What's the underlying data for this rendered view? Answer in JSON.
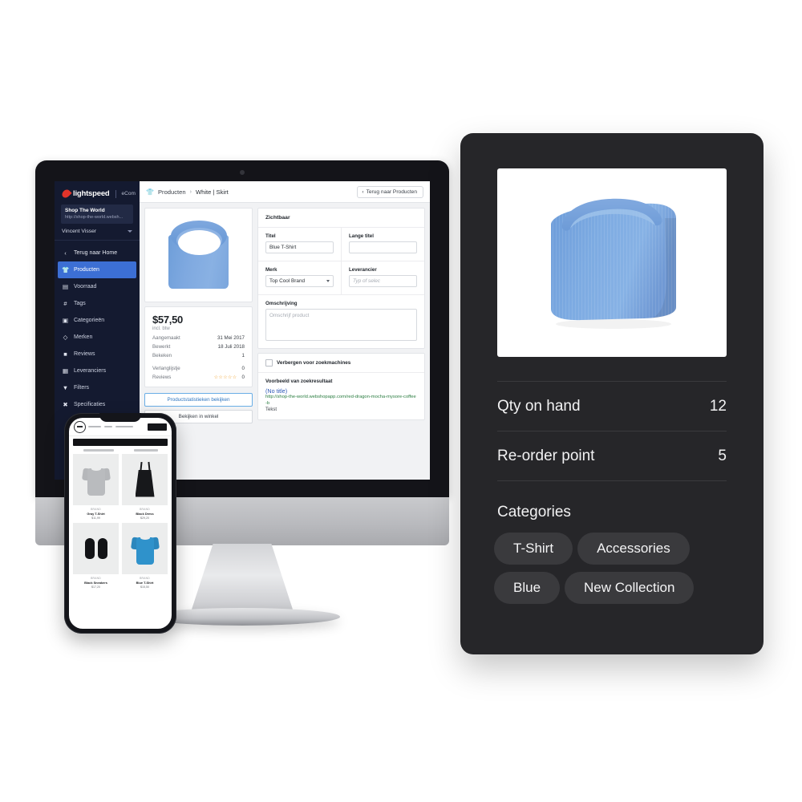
{
  "admin": {
    "brand": {
      "name": "lightspeed",
      "product": "eCom",
      "logo_icon": "flame-icon"
    },
    "shop": {
      "name": "Shop The World",
      "url": "http://shop-the-world.websh..."
    },
    "user": {
      "name": "Vincent Visser"
    },
    "nav": [
      {
        "label": "Terug naar Home",
        "icon": "chevron-left-icon",
        "active": false
      },
      {
        "label": "Producten",
        "icon": "tshirt-icon",
        "active": true
      },
      {
        "label": "Voorraad",
        "icon": "box-icon",
        "active": false
      },
      {
        "label": "Tags",
        "icon": "hash-icon",
        "active": false
      },
      {
        "label": "Categorieën",
        "icon": "folder-icon",
        "active": false
      },
      {
        "label": "Merken",
        "icon": "tag-icon",
        "active": false
      },
      {
        "label": "Reviews",
        "icon": "comment-icon",
        "active": false
      },
      {
        "label": "Leveranciers",
        "icon": "bank-icon",
        "active": false
      },
      {
        "label": "Filters",
        "icon": "filter-icon",
        "active": false
      },
      {
        "label": "Specificaties",
        "icon": "wrench-icon",
        "active": false
      }
    ],
    "breadcrumb": {
      "icon": "tshirt-icon",
      "root": "Producten",
      "separator": "›",
      "current": "White | Skirt"
    },
    "back_button": {
      "label": "Terug naar Producten",
      "icon": "chevron-left-icon"
    },
    "stats": {
      "price": "$57,50",
      "price_note": "incl. btw",
      "rows": [
        {
          "label": "Aangemaakt",
          "value": "31 Mei 2017"
        },
        {
          "label": "Bewerkt",
          "value": "18 Juli 2018"
        },
        {
          "label": "Bekeken",
          "value": "1"
        }
      ],
      "rows2": [
        {
          "label": "Verlanglijstje",
          "value": "0"
        },
        {
          "label": "Reviews",
          "value": "0",
          "stars": "☆☆☆☆☆"
        }
      ],
      "stats_button": "Productstatistieken bekijken",
      "shop_button": "Bekijken in winkel"
    },
    "form": {
      "section_title": "Zichtbaar",
      "title_label": "Titel",
      "title_value": "Blue T-Shirt",
      "long_title_label": "Lange titel",
      "long_title_value": "",
      "brand_label": "Merk",
      "brand_value": "Top Cool Brand",
      "supplier_label": "Leverancier",
      "supplier_placeholder": "Typ of selec",
      "description_label": "Omschrijving",
      "description_placeholder": "Omschrijf product",
      "hide_label": "Verbergen voor zoekmachines",
      "seo_heading": "Voorbeeld van zoekresultaat",
      "seo_title": "(No title)",
      "seo_url": "http://shop-the-world.webshopapp.com/red-dragon-mocha-mysore-coffee-b",
      "seo_text": "Tekst"
    }
  },
  "phone": {
    "products": [
      {
        "brand": "BRAND",
        "name": "Gray T-Shirt",
        "price": "$11,99",
        "art": "tee-gray"
      },
      {
        "brand": "BRAND",
        "name": "Black Dress",
        "price": "$29,20",
        "art": "dress-black"
      },
      {
        "brand": "BRAND",
        "name": "Black Sneakers",
        "price": "$17,20",
        "art": "shoes-black"
      },
      {
        "brand": "BRAND",
        "name": "Blue T-Shirt",
        "price": "$15,50",
        "art": "tee-blue"
      }
    ]
  },
  "detail_card": {
    "product_image_alt": "folded blue ribbed t-shirt",
    "rows": [
      {
        "label": "Qty on hand",
        "value": "12"
      },
      {
        "label": "Re-order point",
        "value": "5"
      }
    ],
    "categories_heading": "Categories",
    "categories": [
      "T-Shirt",
      "Accessories",
      "Blue",
      "New Collection"
    ]
  },
  "colors": {
    "card_bg": "#262629",
    "chip_bg": "#3a3a3d",
    "sidebar_bg": "#141a30",
    "accent_blue": "#3c6fd4",
    "brand_red": "#e2342a",
    "shirt_blue": "#7aa7dd",
    "seo_green": "#2a7d40",
    "seo_link": "#2b57b5",
    "star_orange": "#f0a02a"
  }
}
